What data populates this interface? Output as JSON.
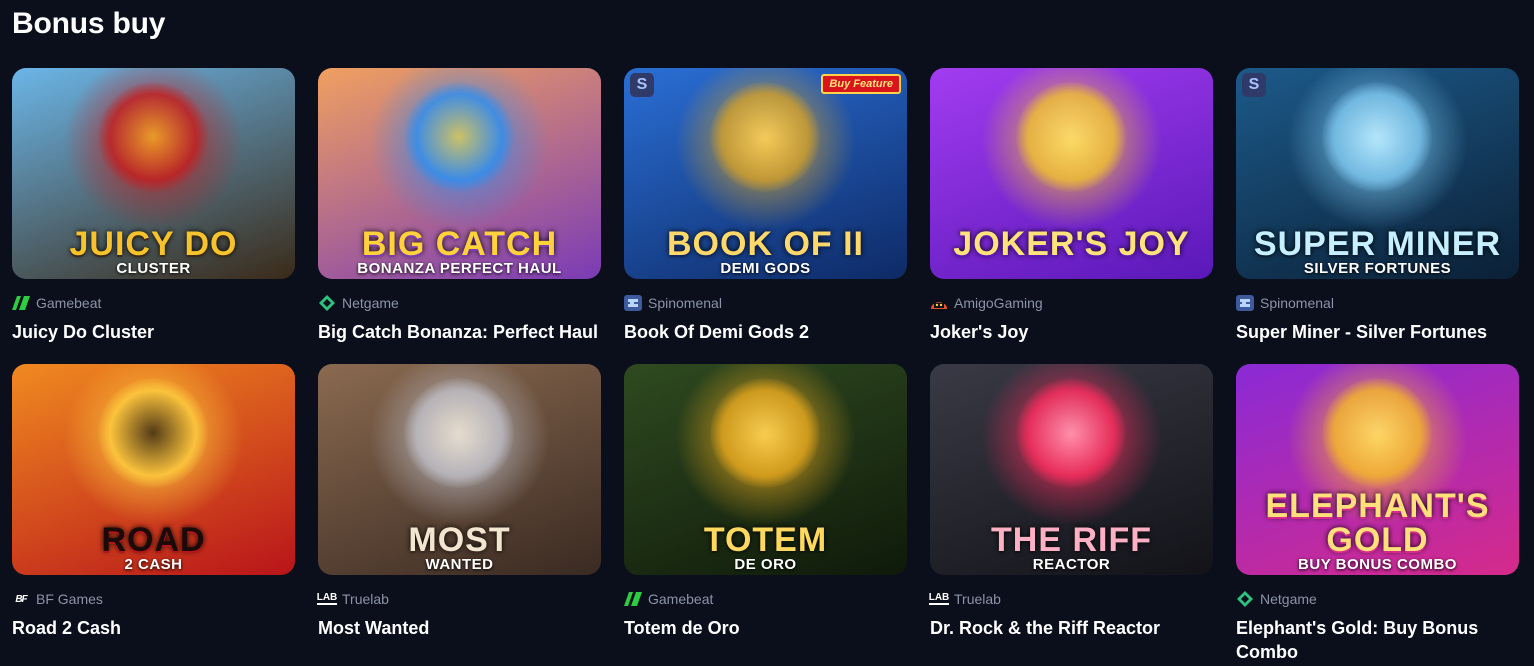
{
  "section": {
    "title": "Bonus buy"
  },
  "games": [
    {
      "name": "Juicy Do Cluster",
      "provider": "Gamebeat",
      "provider_icon": "gamebeat-logo-icon",
      "art_title": "JUICY DO",
      "art_sub": "CLUSTER",
      "colors": [
        "#6bb6e8",
        "#3a2a18",
        "#c41e1e",
        "#f6c32c"
      ]
    },
    {
      "name": "Big Catch Bonanza: Perfect Haul",
      "provider": "Netgame",
      "provider_icon": "netgame-logo-icon",
      "art_title": "BIG CATCH",
      "art_sub": "BONANZA PERFECT HAUL",
      "colors": [
        "#f0a060",
        "#7a3bb6",
        "#2e8ff0",
        "#ffd23a"
      ]
    },
    {
      "name": "Book Of Demi Gods 2",
      "provider": "Spinomenal",
      "provider_icon": "spinomenal-logo-icon",
      "art_title": "BOOK OF II",
      "art_sub": "DEMI GODS",
      "buy_feature": "Buy Feature",
      "colors": [
        "#2a6fd6",
        "#0e2a66",
        "#d4a12a",
        "#ffd86a"
      ]
    },
    {
      "name": "Joker's Joy",
      "provider": "AmigoGaming",
      "provider_icon": "amigogaming-logo-icon",
      "art_title": "JOKER'S JOY",
      "art_sub": "",
      "colors": [
        "#a23cf0",
        "#5a18b8",
        "#f2c230",
        "#ffe27a"
      ]
    },
    {
      "name": "Super Miner - Silver Fortunes",
      "provider": "Spinomenal",
      "provider_icon": "spinomenal-logo-icon",
      "art_title": "SUPER MINER",
      "art_sub": "SILVER FORTUNES",
      "colors": [
        "#1c5a8a",
        "#0b2036",
        "#7ec8f0",
        "#c6f0ff"
      ]
    },
    {
      "name": "Road 2 Cash",
      "provider": "BF Games",
      "provider_icon": "bfgames-logo-icon",
      "art_title": "ROAD",
      "art_sub": "2 CASH",
      "colors": [
        "#f08a20",
        "#b8141a",
        "#ffd040",
        "#1a0a0a"
      ]
    },
    {
      "name": "Most Wanted",
      "provider": "Truelab",
      "provider_icon": "truelab-logo-icon",
      "art_title": "MOST",
      "art_sub": "WANTED",
      "colors": [
        "#8a6a50",
        "#3a2a22",
        "#c0c0c8",
        "#f2e6d0"
      ]
    },
    {
      "name": "Totem de Oro",
      "provider": "Gamebeat",
      "provider_icon": "gamebeat-logo-icon",
      "art_title": "TOTEM",
      "art_sub": "DE ORO",
      "colors": [
        "#2f4a20",
        "#0f1a0a",
        "#e6a81e",
        "#ffd860"
      ]
    },
    {
      "name": "Dr. Rock & the Riff Reactor",
      "provider": "Truelab",
      "provider_icon": "truelab-logo-icon",
      "art_title": "THE RIFF",
      "art_sub": "REACTOR",
      "colors": [
        "#3a3a46",
        "#121218",
        "#ff2e60",
        "#ffb0c4"
      ]
    },
    {
      "name": "Elephant's Gold: Buy Bonus Combo",
      "provider": "Netgame",
      "provider_icon": "netgame-logo-icon",
      "art_title": "ELEPHANT'S GOLD",
      "art_sub": "BUY BONUS COMBO",
      "colors": [
        "#8a2ad6",
        "#d62a8a",
        "#f6b82a",
        "#ffe07a"
      ]
    }
  ]
}
